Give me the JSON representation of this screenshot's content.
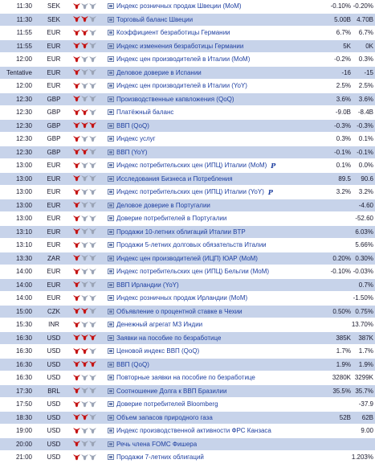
{
  "colors": {
    "row_alt": "#c7d3ea",
    "row_normal": "#ffffff",
    "bull_active": "#c41212",
    "bull_inactive": "#9aa3b5",
    "event_text": "#1e3fa0"
  },
  "icons": {
    "importance": "bull-icon",
    "event": "document-icon",
    "preliminary": "preliminary-p-icon"
  },
  "events": [
    {
      "time": "11:30",
      "currency": "SEK",
      "importance": 1,
      "event": "Индекс розничных продаж Швеции (MoM)",
      "actual": "",
      "forecast": "-0.10%",
      "previous": "-0.20%",
      "alt": false,
      "prelim": false
    },
    {
      "time": "11:30",
      "currency": "SEK",
      "importance": 2,
      "event": "Торговый баланс Швеции",
      "actual": "",
      "forecast": "5.00B",
      "previous": "4.70B",
      "alt": true,
      "prelim": false
    },
    {
      "time": "11:55",
      "currency": "EUR",
      "importance": 2,
      "event": "Коэффициент безработицы Германии",
      "actual": "",
      "forecast": "6.7%",
      "previous": "6.7%",
      "alt": false,
      "prelim": false
    },
    {
      "time": "11:55",
      "currency": "EUR",
      "importance": 2,
      "event": "Индекс изменения безработицы Германии",
      "actual": "",
      "forecast": "5K",
      "previous": "0K",
      "alt": true,
      "prelim": false
    },
    {
      "time": "12:00",
      "currency": "EUR",
      "importance": 1,
      "event": "Индекс цен производителей в Италии (MoM)",
      "actual": "",
      "forecast": "-0.2%",
      "previous": "0.3%",
      "alt": false,
      "prelim": false
    },
    {
      "time": "Tentative",
      "currency": "EUR",
      "importance": 1,
      "event": "Деловое доверие в Испании",
      "actual": "",
      "forecast": "-16",
      "previous": "-15",
      "alt": true,
      "prelim": false
    },
    {
      "time": "12:00",
      "currency": "EUR",
      "importance": 1,
      "event": "Индекс цен производителей в Италии (YoY)",
      "actual": "",
      "forecast": "2.5%",
      "previous": "2.5%",
      "alt": false,
      "prelim": false
    },
    {
      "time": "12:30",
      "currency": "GBP",
      "importance": 1,
      "event": "Производственные капвложения (QoQ)",
      "actual": "",
      "forecast": "3.6%",
      "previous": "3.6%",
      "alt": true,
      "prelim": false
    },
    {
      "time": "12:30",
      "currency": "GBP",
      "importance": 2,
      "event": "Платёжный баланс",
      "actual": "",
      "forecast": "-9.0B",
      "previous": "-8.4B",
      "alt": false,
      "prelim": false
    },
    {
      "time": "12:30",
      "currency": "GBP",
      "importance": 3,
      "event": "ВВП (QoQ)",
      "actual": "",
      "forecast": "-0.3%",
      "previous": "-0.3%",
      "alt": true,
      "prelim": false
    },
    {
      "time": "12:30",
      "currency": "GBP",
      "importance": 1,
      "event": "Индекс услуг",
      "actual": "",
      "forecast": "0.3%",
      "previous": "0.1%",
      "alt": false,
      "prelim": false
    },
    {
      "time": "12:30",
      "currency": "GBP",
      "importance": 2,
      "event": "ВВП (YoY)",
      "actual": "",
      "forecast": "-0.1%",
      "previous": "-0.1%",
      "alt": true,
      "prelim": false
    },
    {
      "time": "13:00",
      "currency": "EUR",
      "importance": 1,
      "event": "Индекс потребительских цен (ИПЦ) Италии (MoM)",
      "actual": "",
      "forecast": "0.1%",
      "previous": "0.0%",
      "alt": false,
      "prelim": true
    },
    {
      "time": "13:00",
      "currency": "EUR",
      "importance": 1,
      "event": "Исследования Бизнеса и Потребления",
      "actual": "",
      "forecast": "89.5",
      "previous": "90.6",
      "alt": true,
      "prelim": false
    },
    {
      "time": "13:00",
      "currency": "EUR",
      "importance": 1,
      "event": "Индекс потребительских цен (ИПЦ) Италии (YoY)",
      "actual": "",
      "forecast": "3.2%",
      "previous": "3.2%",
      "alt": false,
      "prelim": true
    },
    {
      "time": "13:00",
      "currency": "EUR",
      "importance": 1,
      "event": "Деловое доверие в Португалии",
      "actual": "",
      "forecast": "",
      "previous": "-4.60",
      "alt": true,
      "prelim": false
    },
    {
      "time": "13:00",
      "currency": "EUR",
      "importance": 1,
      "event": "Доверие потребителей в Португалии",
      "actual": "",
      "forecast": "",
      "previous": "-52.60",
      "alt": false,
      "prelim": false
    },
    {
      "time": "13:10",
      "currency": "EUR",
      "importance": 1,
      "event": "Продажи 10-летних облигаций Италии BTP",
      "actual": "",
      "forecast": "",
      "previous": "6.03%",
      "alt": true,
      "prelim": false
    },
    {
      "time": "13:10",
      "currency": "EUR",
      "importance": 1,
      "event": "Продажи 5-летних долговых обязательств Италии",
      "actual": "",
      "forecast": "",
      "previous": "5.66%",
      "alt": false,
      "prelim": false
    },
    {
      "time": "13:30",
      "currency": "ZAR",
      "importance": 1,
      "event": "Индекс цен производителей (ИЦП) ЮАР (MoM)",
      "actual": "",
      "forecast": "0.20%",
      "previous": "0.30%",
      "alt": true,
      "prelim": false
    },
    {
      "time": "14:00",
      "currency": "EUR",
      "importance": 1,
      "event": "Индекс потребительских цен (ИПЦ) Бельгии (MoM)",
      "actual": "",
      "forecast": "-0.10%",
      "previous": "-0.03%",
      "alt": false,
      "prelim": false
    },
    {
      "time": "14:00",
      "currency": "EUR",
      "importance": 1,
      "event": "ВВП Ирландии (YoY)",
      "actual": "",
      "forecast": "",
      "previous": "0.7%",
      "alt": true,
      "prelim": false
    },
    {
      "time": "14:00",
      "currency": "EUR",
      "importance": 1,
      "event": "Индекс розничных продаж Ирландии (MoM)",
      "actual": "",
      "forecast": "",
      "previous": "-1.50%",
      "alt": false,
      "prelim": false
    },
    {
      "time": "15:00",
      "currency": "CZK",
      "importance": 2,
      "event": "Объявление о процентной ставке в Чехии",
      "actual": "",
      "forecast": "0.50%",
      "previous": "0.75%",
      "alt": true,
      "prelim": false
    },
    {
      "time": "15:30",
      "currency": "INR",
      "importance": 1,
      "event": "Денежный агрегат М3 Индии",
      "actual": "",
      "forecast": "",
      "previous": "13.70%",
      "alt": false,
      "prelim": false
    },
    {
      "time": "16:30",
      "currency": "USD",
      "importance": 3,
      "event": "Заявки на пособие по безработице",
      "actual": "",
      "forecast": "385K",
      "previous": "387K",
      "alt": true,
      "prelim": false
    },
    {
      "time": "16:30",
      "currency": "USD",
      "importance": 2,
      "event": "Ценовой индекс ВВП (QoQ)",
      "actual": "",
      "forecast": "1.7%",
      "previous": "1.7%",
      "alt": false,
      "prelim": false
    },
    {
      "time": "16:30",
      "currency": "USD",
      "importance": 3,
      "event": "ВВП (QoQ)",
      "actual": "",
      "forecast": "1.9%",
      "previous": "1.9%",
      "alt": true,
      "prelim": false
    },
    {
      "time": "16:30",
      "currency": "USD",
      "importance": 1,
      "event": "Повторные заявки на пособие по безработице",
      "actual": "",
      "forecast": "3280K",
      "previous": "3299K",
      "alt": false,
      "prelim": false
    },
    {
      "time": "17:30",
      "currency": "BRL",
      "importance": 1,
      "event": "Соотношение Долга к ВВП Бразилии",
      "actual": "",
      "forecast": "35.5%",
      "previous": "35.7%",
      "alt": true,
      "prelim": false
    },
    {
      "time": "17:50",
      "currency": "USD",
      "importance": 1,
      "event": "Доверие потребителей Bloomberg",
      "actual": "",
      "forecast": "",
      "previous": "-37.9",
      "alt": false,
      "prelim": false
    },
    {
      "time": "18:30",
      "currency": "USD",
      "importance": 2,
      "event": "Объем запасов природного газа",
      "actual": "",
      "forecast": "52B",
      "previous": "62B",
      "alt": true,
      "prelim": false
    },
    {
      "time": "19:00",
      "currency": "USD",
      "importance": 1,
      "event": "Индекс производственной активности ФРС Канзаса",
      "actual": "",
      "forecast": "",
      "previous": "9.00",
      "alt": false,
      "prelim": false
    },
    {
      "time": "20:00",
      "currency": "USD",
      "importance": 1,
      "event": "Речь члена FOMC Фишера",
      "actual": "",
      "forecast": "",
      "previous": "",
      "alt": true,
      "prelim": false
    },
    {
      "time": "21:00",
      "currency": "USD",
      "importance": 1,
      "event": "Продажи 7-летних облигаций",
      "actual": "",
      "forecast": "",
      "previous": "1.203%",
      "alt": false,
      "prelim": false
    }
  ]
}
